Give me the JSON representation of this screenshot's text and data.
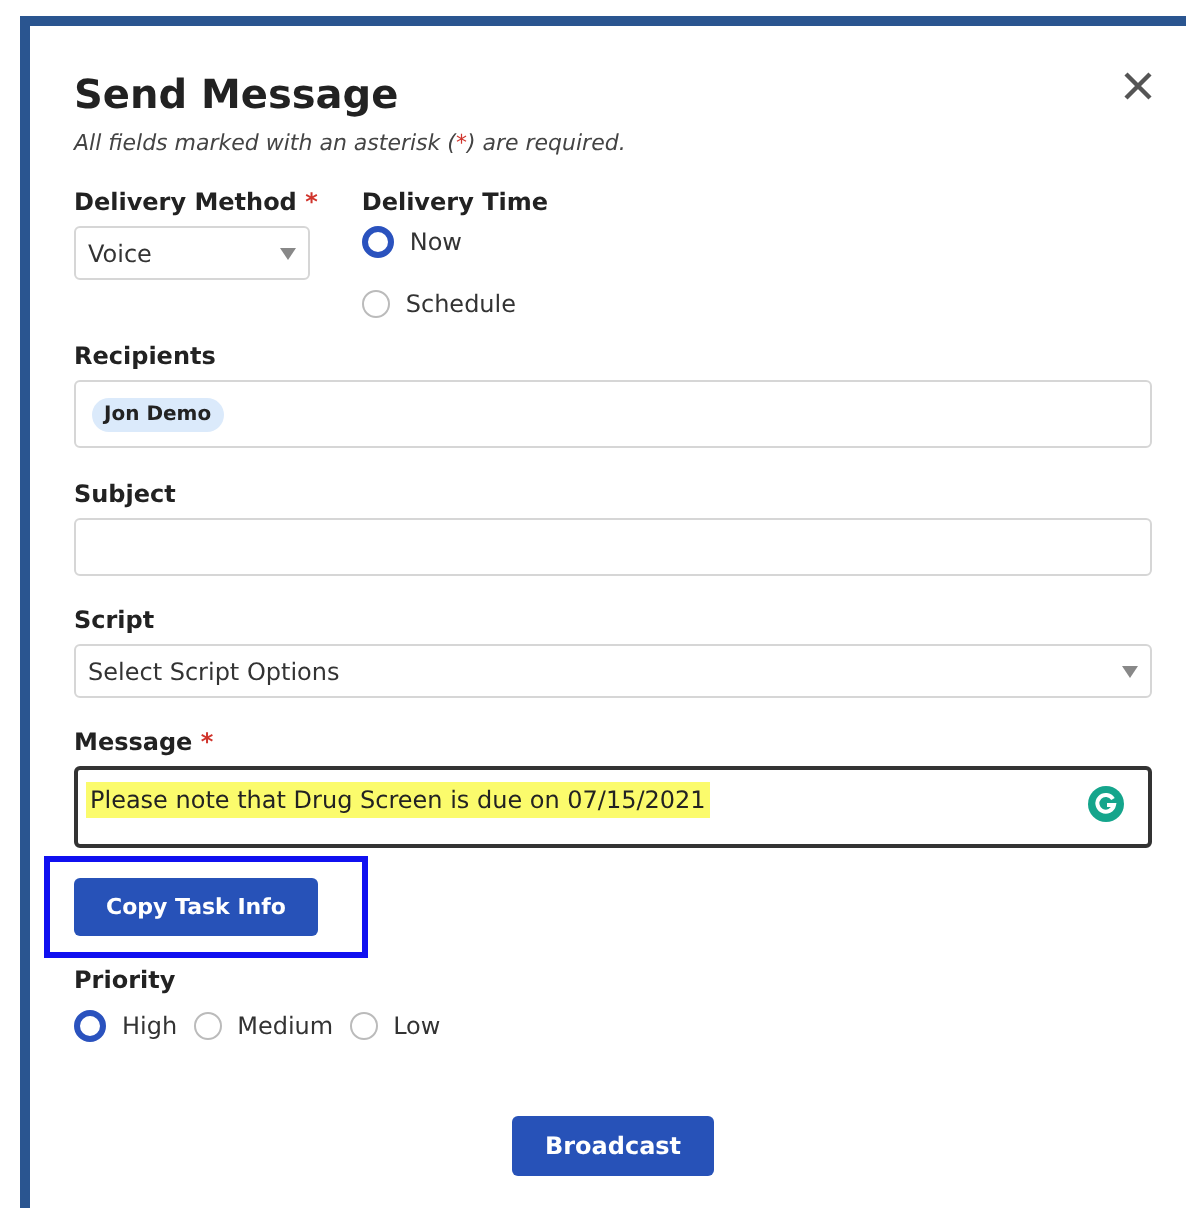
{
  "dialog": {
    "title": "Send Message",
    "required_note": {
      "before": "All fields marked with an asterisk (",
      "mark": "*",
      "after": ") are required."
    }
  },
  "delivery_method": {
    "label": "Delivery Method",
    "required": true,
    "value": "Voice"
  },
  "delivery_time": {
    "label": "Delivery Time",
    "options": [
      {
        "label": "Now",
        "selected": true
      },
      {
        "label": "Schedule",
        "selected": false
      }
    ]
  },
  "recipients": {
    "label": "Recipients",
    "chips": [
      "Jon Demo"
    ]
  },
  "subject": {
    "label": "Subject"
  },
  "script": {
    "label": "Script",
    "value": "Select Script Options"
  },
  "message": {
    "label": "Message",
    "required": true,
    "value": "Please note that Drug Screen is due on 07/15/2021",
    "highlighted": true
  },
  "copy_button": {
    "label": "Copy Task Info",
    "outlined": true
  },
  "priority": {
    "label": "Priority",
    "options": [
      {
        "label": "High",
        "selected": true
      },
      {
        "label": "Medium",
        "selected": false
      },
      {
        "label": "Low",
        "selected": false
      }
    ]
  },
  "submit_button": {
    "label": "Broadcast"
  }
}
